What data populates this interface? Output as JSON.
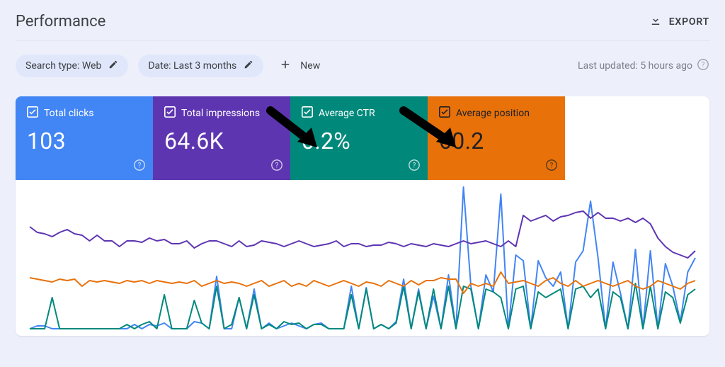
{
  "page_title": "Performance",
  "export_label": "EXPORT",
  "filters": {
    "search_type": "Search type: Web",
    "date_range": "Date: Last 3 months",
    "new_label": "New"
  },
  "last_updated": "Last updated: 5 hours ago",
  "metrics": [
    {
      "label": "Total clicks",
      "value": "103",
      "color": "#4285f4"
    },
    {
      "label": "Total impressions",
      "value": "64.6K",
      "color": "#5e35b1"
    },
    {
      "label": "Average CTR",
      "value": "0.2%",
      "color": "#00897b"
    },
    {
      "label": "Average position",
      "value": "60.2",
      "color": "#e8710a"
    }
  ],
  "chart_data": {
    "type": "line",
    "title": "",
    "xlabel": "",
    "ylabel": "",
    "x": [
      0,
      1,
      2,
      3,
      4,
      5,
      6,
      7,
      8,
      9,
      10,
      11,
      12,
      13,
      14,
      15,
      16,
      17,
      18,
      19,
      20,
      21,
      22,
      23,
      24,
      25,
      26,
      27,
      28,
      29,
      30,
      31,
      32,
      33,
      34,
      35,
      36,
      37,
      38,
      39,
      40,
      41,
      42,
      43,
      44,
      45,
      46,
      47,
      48,
      49,
      50,
      51,
      52,
      53,
      54,
      55,
      56,
      57,
      58,
      59,
      60,
      61,
      62,
      63,
      64,
      65,
      66,
      67,
      68,
      69,
      70,
      71,
      72,
      73,
      74,
      75,
      76,
      77,
      78,
      79,
      80,
      81,
      82,
      83,
      84,
      85,
      86,
      87,
      88,
      89
    ],
    "ylim": [
      0,
      100
    ],
    "series": [
      {
        "name": "Total clicks",
        "color": "#4285f4",
        "values": [
          0,
          2,
          2,
          0,
          0,
          0,
          0,
          0,
          0,
          0,
          0,
          0,
          0,
          0,
          3,
          0,
          3,
          2,
          4,
          0,
          0,
          0,
          5,
          4,
          0,
          37,
          0,
          0,
          22,
          0,
          28,
          0,
          4,
          0,
          2,
          4,
          2,
          0,
          3,
          4,
          0,
          0,
          0,
          30,
          0,
          29,
          0,
          3,
          0,
          5,
          35,
          0,
          28,
          0,
          23,
          0,
          38,
          0,
          100,
          30,
          0,
          38,
          26,
          95,
          0,
          52,
          48,
          0,
          48,
          36,
          30,
          40,
          0,
          47,
          55,
          90,
          50,
          0,
          47,
          25,
          0,
          56,
          0,
          55,
          0,
          46,
          30,
          5,
          40,
          50
        ]
      },
      {
        "name": "Total impressions",
        "color": "#5e35b1",
        "values": [
          72,
          68,
          67,
          65,
          68,
          70,
          67,
          66,
          62,
          66,
          62,
          62,
          58,
          62,
          62,
          61,
          64,
          62,
          63,
          60,
          60,
          62,
          57,
          60,
          62,
          62,
          60,
          58,
          62,
          58,
          59,
          62,
          61,
          60,
          58,
          60,
          62,
          60,
          58,
          59,
          60,
          62,
          58,
          60,
          60,
          58,
          59,
          59,
          61,
          60,
          58,
          60,
          59,
          58,
          60,
          59,
          58,
          60,
          62,
          60,
          61,
          62,
          60,
          58,
          62,
          58,
          80,
          76,
          78,
          80,
          76,
          79,
          80,
          82,
          83,
          78,
          82,
          78,
          78,
          76,
          78,
          75,
          78,
          74,
          64,
          58,
          54,
          52,
          50,
          55
        ]
      },
      {
        "name": "Average CTR",
        "color": "#00897b",
        "values": [
          0,
          0,
          0,
          22,
          0,
          0,
          0,
          0,
          0,
          0,
          0,
          0,
          0,
          3,
          0,
          3,
          5,
          0,
          24,
          0,
          0,
          0,
          20,
          4,
          0,
          30,
          0,
          3,
          22,
          0,
          24,
          0,
          3,
          0,
          5,
          3,
          4,
          0,
          3,
          3,
          0,
          0,
          0,
          24,
          0,
          28,
          0,
          3,
          0,
          4,
          30,
          0,
          26,
          0,
          28,
          0,
          30,
          0,
          30,
          28,
          0,
          28,
          26,
          22,
          0,
          28,
          30,
          0,
          26,
          22,
          25,
          28,
          0,
          28,
          30,
          22,
          28,
          0,
          26,
          22,
          0,
          32,
          0,
          30,
          0,
          26,
          22,
          4,
          24,
          28
        ]
      },
      {
        "name": "Average position",
        "color": "#e8710a",
        "values": [
          36,
          35,
          34,
          33,
          35,
          34,
          35,
          30,
          34,
          33,
          34,
          33,
          32,
          34,
          33,
          34,
          32,
          34,
          33,
          32,
          33,
          32,
          34,
          30,
          32,
          34,
          32,
          33,
          32,
          30,
          32,
          34,
          30,
          32,
          34,
          30,
          32,
          30,
          34,
          32,
          30,
          32,
          34,
          32,
          30,
          33,
          32,
          30,
          34,
          32,
          30,
          34,
          31,
          34,
          34,
          36,
          35,
          35,
          25,
          32,
          30,
          32,
          30,
          40,
          32,
          33,
          34,
          32,
          30,
          34,
          36,
          32,
          30,
          34,
          30,
          32,
          34,
          32,
          30,
          32,
          34,
          30,
          28,
          30,
          34,
          32,
          30,
          28,
          32,
          34
        ]
      }
    ]
  }
}
